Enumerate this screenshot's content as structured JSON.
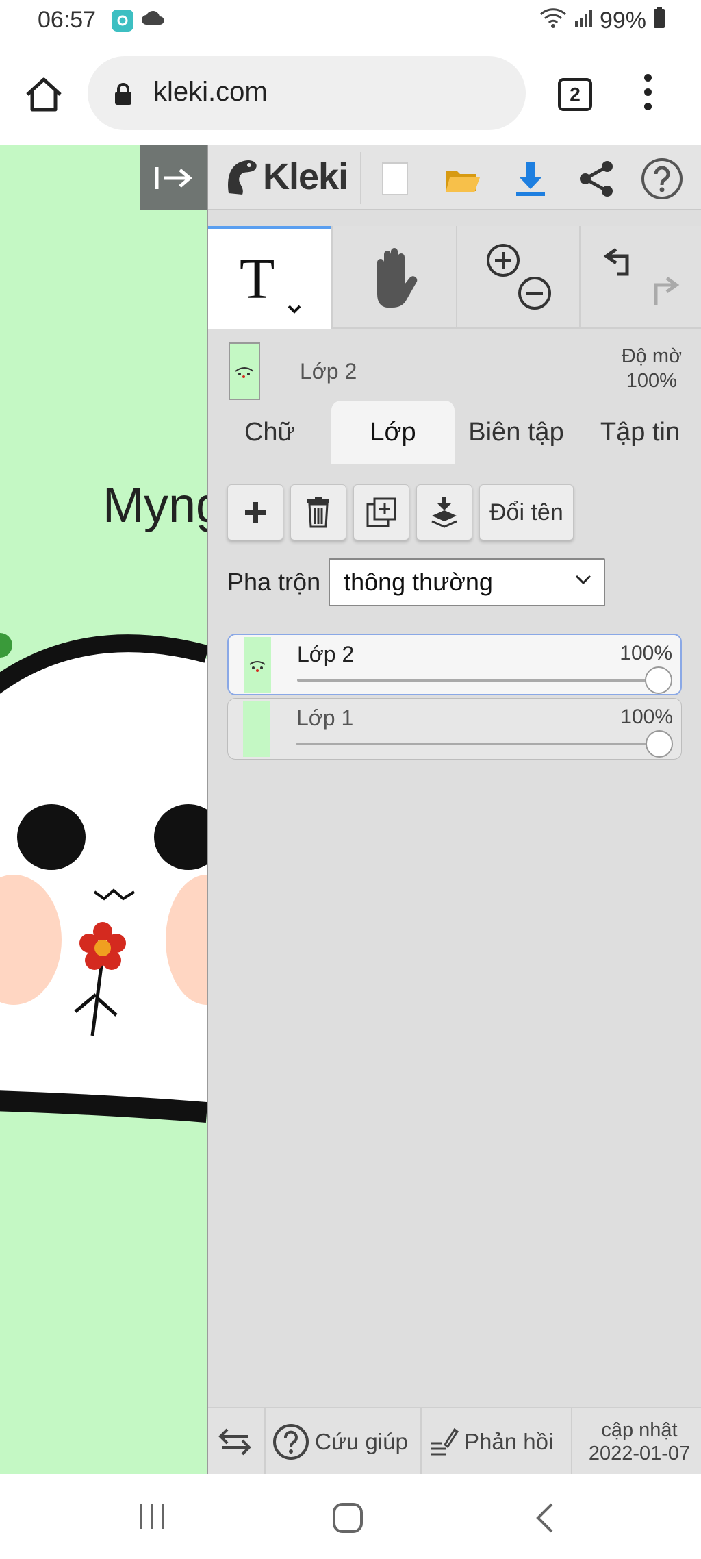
{
  "status_bar": {
    "time": "06:57",
    "battery": "99%"
  },
  "browser": {
    "url": "kleki.com",
    "tab_count": "2"
  },
  "canvas": {
    "text": "Myng",
    "background": "#c4f8c4"
  },
  "app": {
    "logo_text": "Kleki",
    "layer_preview": {
      "name": "Lớp 2",
      "opacity_label": "Độ mờ",
      "opacity_value": "100%"
    },
    "tabs": [
      {
        "label": "Chữ"
      },
      {
        "label": "Lớp"
      },
      {
        "label": "Biên tập"
      },
      {
        "label": "Tập tin"
      }
    ],
    "layer_buttons": {
      "rename": "Đổi tên"
    },
    "blend": {
      "label": "Pha trộn",
      "value": "thông thường"
    },
    "layers": [
      {
        "name": "Lớp 2",
        "opacity": "100%"
      },
      {
        "name": "Lớp 1",
        "opacity": "100%"
      }
    ],
    "footer": {
      "help": "Cứu giúp",
      "feedback": "Phản hồi",
      "update_label": "cập nhật",
      "update_date": "2022-01-07"
    }
  }
}
